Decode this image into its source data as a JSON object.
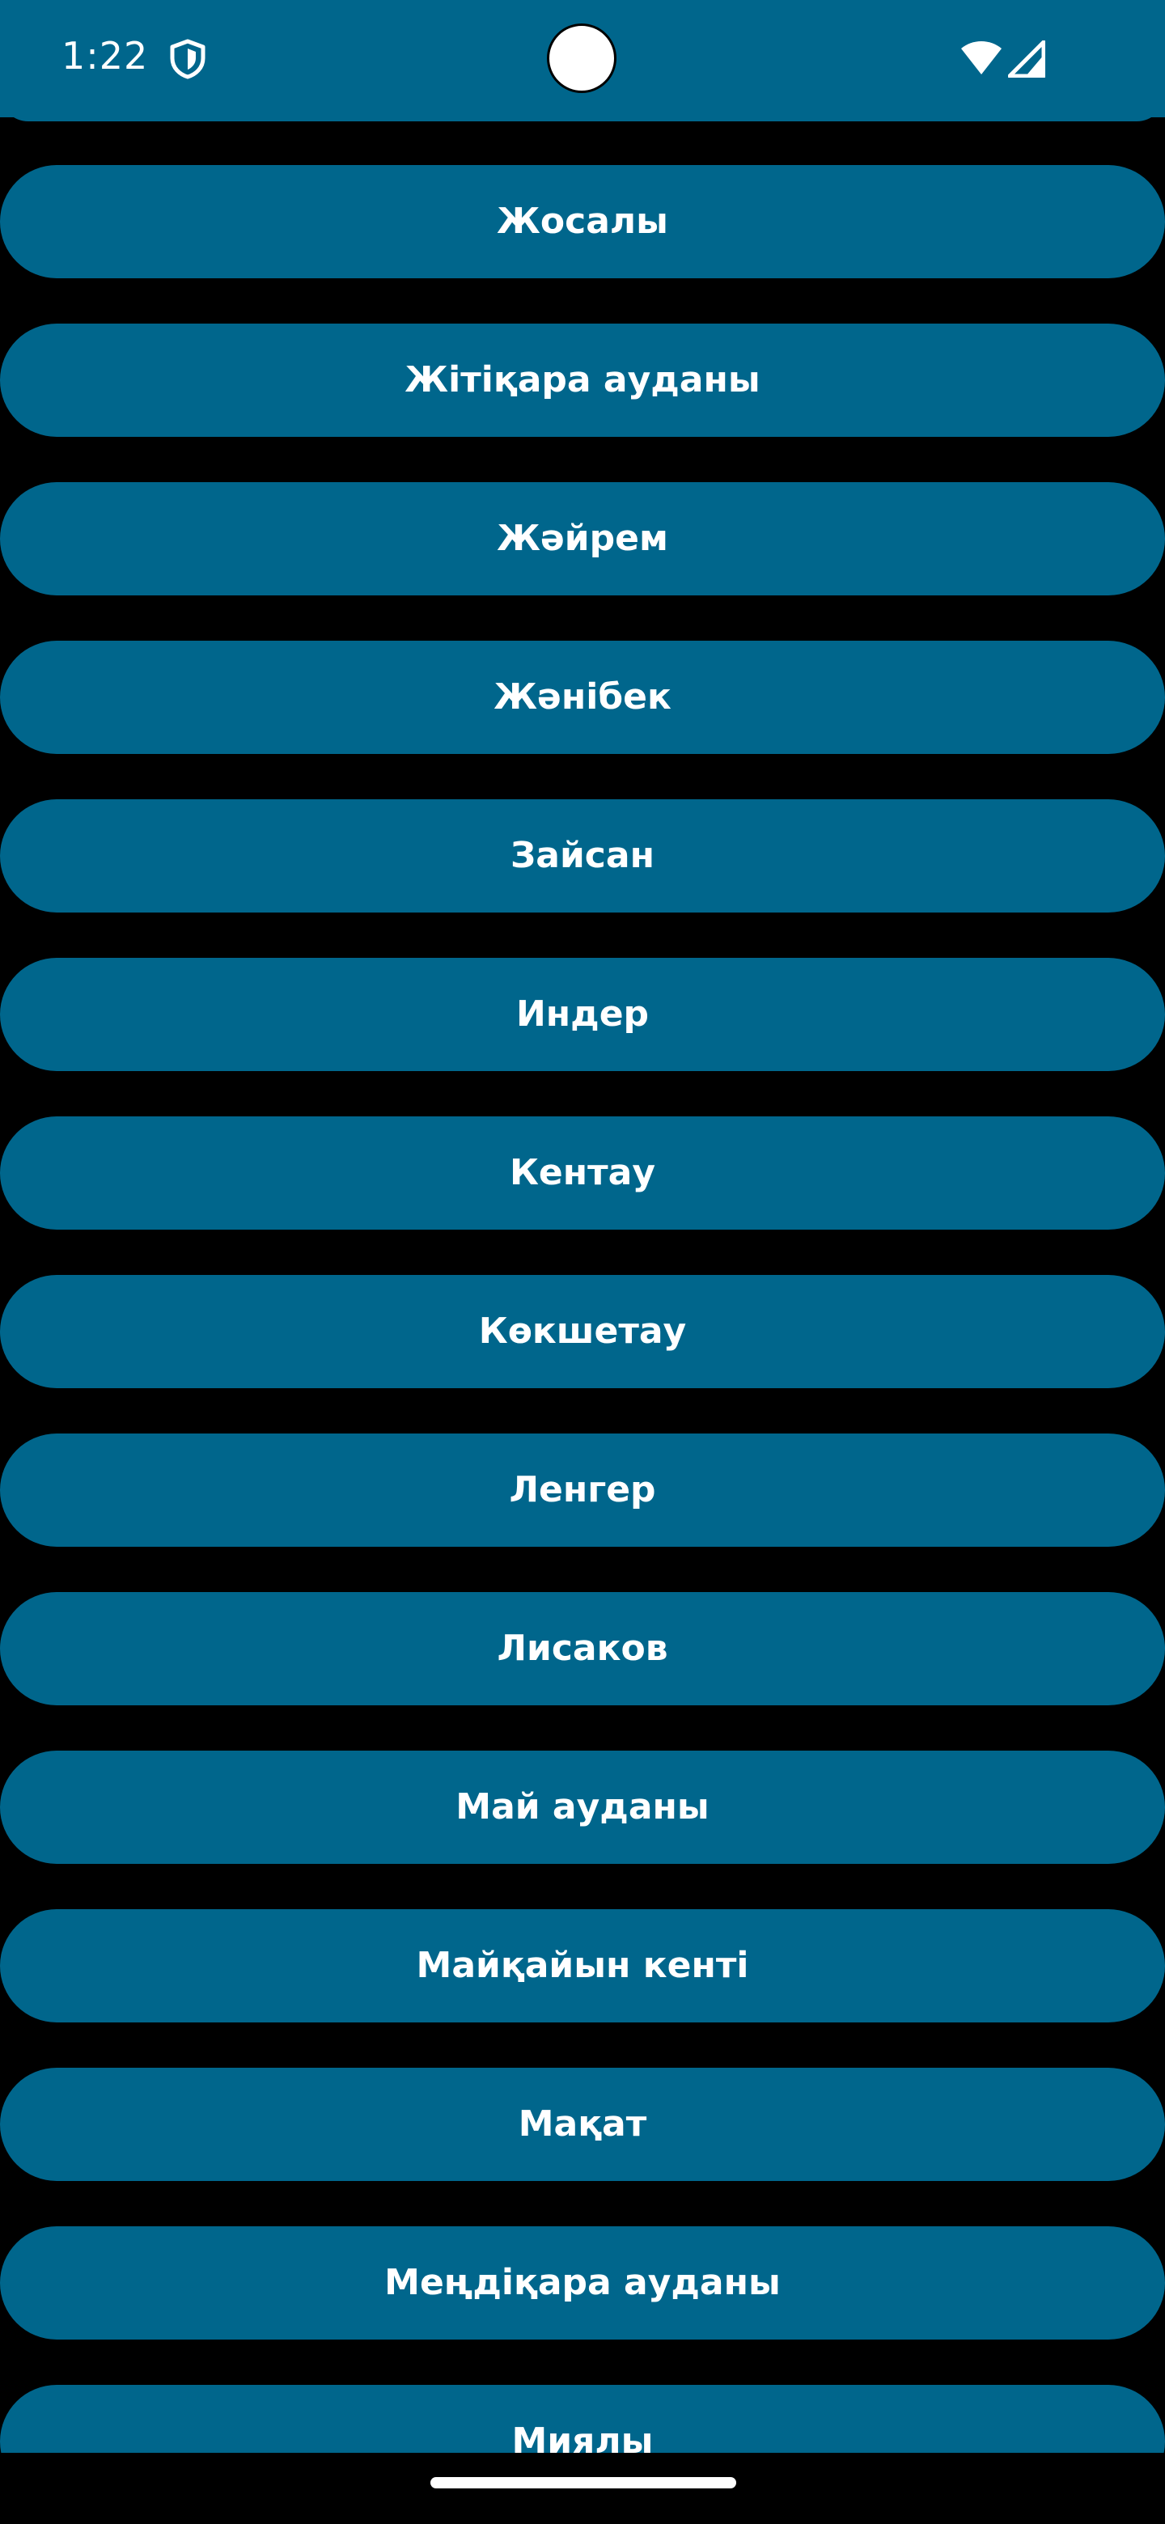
{
  "status_bar": {
    "time": "1:22",
    "shield_icon": "shield-icon",
    "wifi_icon": "wifi-icon",
    "signal_icon": "cell-signal-icon",
    "background_color": "#00668c"
  },
  "city_list": {
    "button_color": "#00668c",
    "text_color": "#ffffff",
    "items": [
      "Жосалы",
      "Жітіқара ауданы",
      "Жәйрем",
      "Жәнібек",
      "Зайсан",
      "Индер",
      "Кентау",
      "Көкшетау",
      "Ленгер",
      "Лисаков",
      "Май ауданы",
      "Майқайын кенті",
      "Мақат",
      "Меңдіқара ауданы",
      "Миялы"
    ]
  }
}
